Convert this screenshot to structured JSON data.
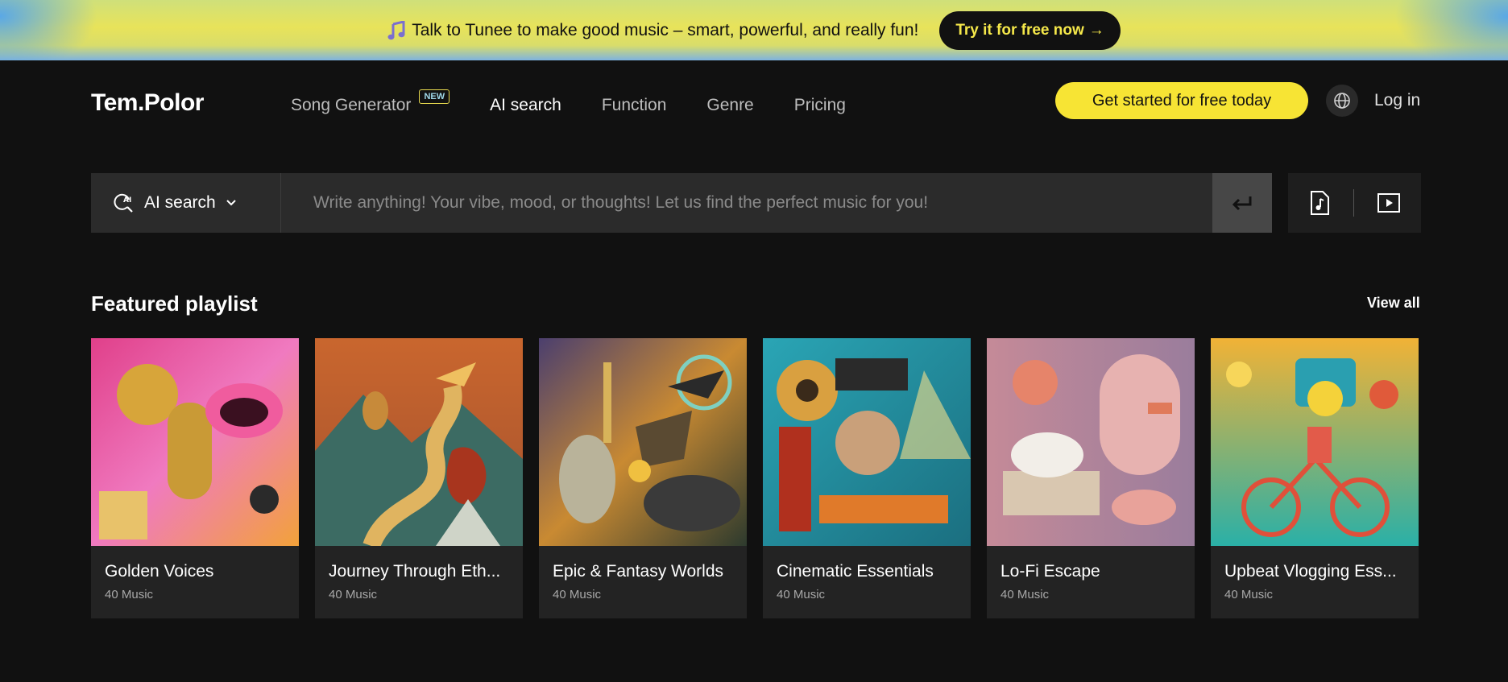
{
  "banner": {
    "text": "Talk to Tunee to make good music – smart, powerful, and really fun!",
    "button": "Try it for free now",
    "button_arrow": "→"
  },
  "header": {
    "logo": "Tem.Polor",
    "nav": [
      {
        "label": "Song Generator",
        "badge": "NEW"
      },
      {
        "label": "AI search"
      },
      {
        "label": "Function"
      },
      {
        "label": "Genre"
      },
      {
        "label": "Pricing"
      }
    ],
    "cta": "Get started for free today",
    "login": "Log in"
  },
  "search": {
    "mode_label": "AI search",
    "mode_icon": "ai-search-icon",
    "placeholder": "Write anything! Your vibe, mood, or thoughts! Let us find the perfect music for you!"
  },
  "featured": {
    "title": "Featured playlist",
    "view_all": "View all",
    "playlists": [
      {
        "title": "Golden Voices",
        "count": "40 Music",
        "colors": [
          "#f2a23a",
          "#e0408a"
        ]
      },
      {
        "title": "Journey Through Eth...",
        "count": "40 Music",
        "colors": [
          "#c9662e",
          "#3c6b63"
        ]
      },
      {
        "title": "Epic & Fantasy Worlds",
        "count": "40 Music",
        "colors": [
          "#3a5a4a",
          "#d3a040"
        ]
      },
      {
        "title": "Cinematic Essentials",
        "count": "40 Music",
        "colors": [
          "#2aa5b5",
          "#e07a2a"
        ]
      },
      {
        "title": "Lo-Fi Escape",
        "count": "40 Music",
        "colors": [
          "#c58a98",
          "#6fa7a0"
        ]
      },
      {
        "title": "Upbeat Vlogging Ess...",
        "count": "40 Music",
        "colors": [
          "#f1b236",
          "#2ab0a7"
        ]
      }
    ]
  },
  "colors": {
    "accent_yellow": "#f7e434",
    "background": "#111111",
    "card": "#232323"
  }
}
